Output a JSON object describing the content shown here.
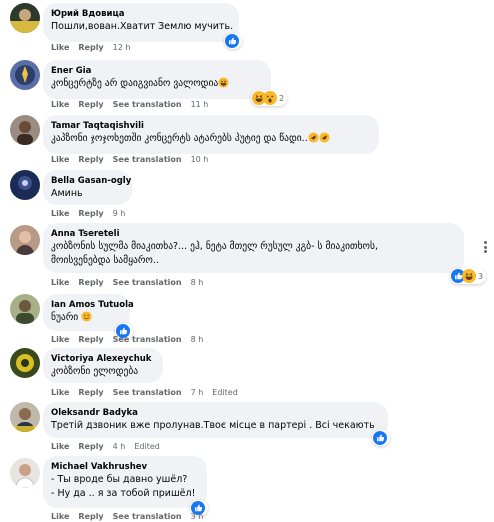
{
  "comments": [
    {
      "author": "Юрий Вдовица",
      "lines": [
        "Пошли,вован.Хватит Землю мучить."
      ],
      "like": "Like",
      "reply": "Reply",
      "time": "12 h",
      "reaction_icons": [
        "like"
      ],
      "reaction_count": ""
    },
    {
      "author": "Ener Gia",
      "lines": [
        "კონცერტზე არ დაიგვიანო ვალოდია"
      ],
      "like": "Like",
      "reply": "Reply",
      "see_translation": "See translation",
      "time": "11 h",
      "reaction_icons": [
        "haha",
        "wow"
      ],
      "reaction_count": "2"
    },
    {
      "author": "Tamar Taqtaqishvili",
      "lines": [
        "კაპზონი ჯოჯოხეთში კონცერტს ატარებს პუტიე და წადი.."
      ],
      "like": "Like",
      "reply": "Reply",
      "see_translation": "See translation",
      "time": "10 h"
    },
    {
      "author": "Bella Gasan-ogly",
      "lines": [
        "Аминь"
      ],
      "like": "Like",
      "reply": "Reply",
      "time": "9 h"
    },
    {
      "author": "Anna Tsereteli",
      "lines": [
        "კობზონის სულმა მიაკითხა?... ეჰ, ნეტა მთელ რუსულ კგბ- ს მიაკითხოს,",
        "მოისვენებდა სამყარო.."
      ],
      "like": "Like",
      "reply": "Reply",
      "see_translation": "See translation",
      "time": "8 h",
      "reaction_icons": [
        "like",
        "haha"
      ],
      "reaction_count": "3"
    },
    {
      "author": "Ian Amos Tutuola",
      "lines": [
        "ნუარი"
      ],
      "like": "Like",
      "reply": "Reply",
      "see_translation": "See translation",
      "time": "8 h",
      "reaction_icons": [
        "like"
      ],
      "reaction_count": ""
    },
    {
      "author": "Victoriya Alexeychuk",
      "lines": [
        "კობზონი ელოდება"
      ],
      "like": "Like",
      "reply": "Reply",
      "see_translation": "See translation",
      "time": "7 h",
      "edited": "Edited"
    },
    {
      "author": "Oleksandr Badyka",
      "lines": [
        "Третій дзвоник вже пролунав.Твоє місце в партері . Всі чекають"
      ],
      "like": "Like",
      "reply": "Reply",
      "time": "4 h",
      "edited": "Edited",
      "reaction_icons": [
        "like"
      ],
      "reaction_count": ""
    },
    {
      "author": "Michael Vakhrushev",
      "lines": [
        "- Ты вроде бы давно ушёл?",
        "- Ну да .. я за тобой пришёл!"
      ],
      "like": "Like",
      "reply": "Reply",
      "see_translation": "See translation",
      "time": "3 h",
      "reaction_icons": [
        "like"
      ],
      "reaction_count": ""
    }
  ],
  "colors": {
    "bubble": "#f0f2f5",
    "meta": "#65676b",
    "like_blue": "#1877f2",
    "haha_yellow": "#f7b928"
  }
}
